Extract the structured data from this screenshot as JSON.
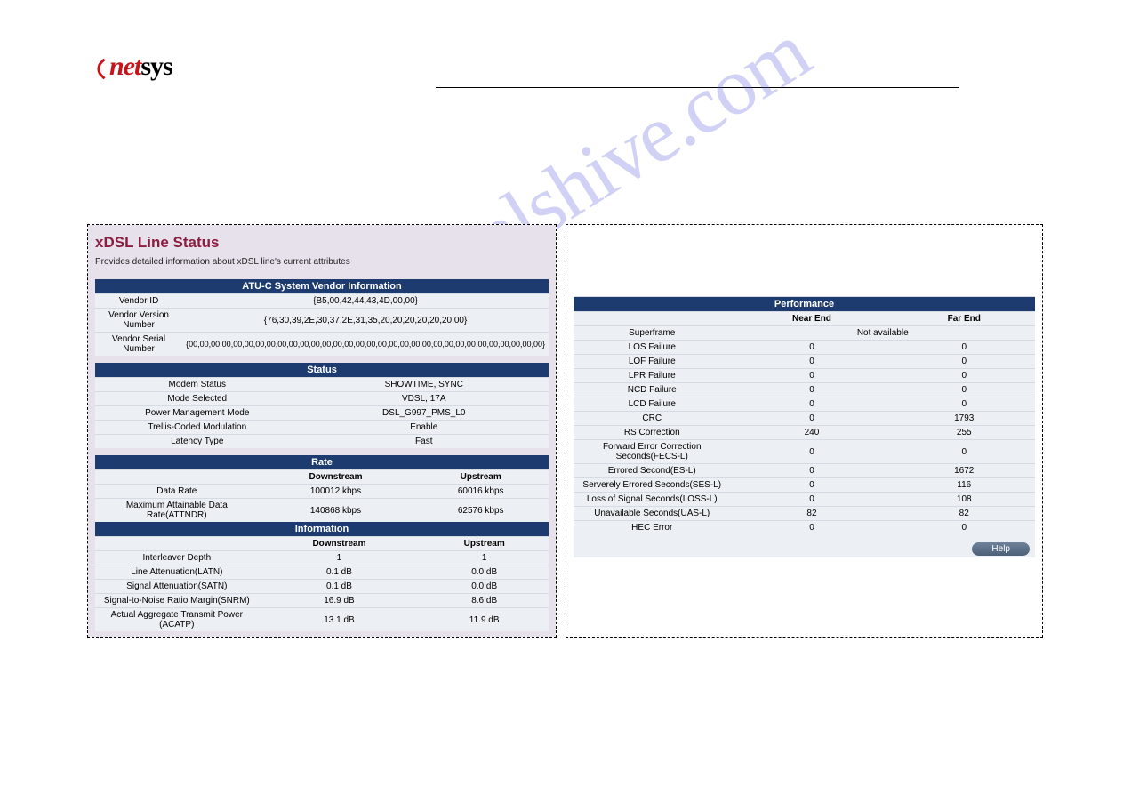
{
  "logo": {
    "part1": "net",
    "part2": "sys"
  },
  "watermark": "manualshive.com",
  "left": {
    "title": "xDSL Line Status",
    "subtitle": "Provides detailed information about xDSL line's current attributes",
    "vendor_section": "ATU-C System Vendor Information",
    "vendor_rows": [
      {
        "label": "Vendor ID",
        "value": "{B5,00,42,44,43,4D,00,00}"
      },
      {
        "label": "Vendor Version Number",
        "value": "{76,30,39,2E,30,37,2E,31,35,20,20,20,20,20,20,00}"
      },
      {
        "label": "Vendor Serial Number",
        "value": "{00,00,00,00,00,00,00,00,00,00,00,00,00,00,00,00,00,00,00,00,00,00,00,00,00,00,00,00,00,00,00,00}"
      }
    ],
    "status_section": "Status",
    "status_rows": [
      {
        "label": "Modem Status",
        "value": "SHOWTIME, SYNC"
      },
      {
        "label": "Mode Selected",
        "value": "VDSL, 17A"
      },
      {
        "label": "Power Management Mode",
        "value": "DSL_G997_PMS_L0"
      },
      {
        "label": "Trellis-Coded Modulation",
        "value": "Enable"
      },
      {
        "label": "Latency Type",
        "value": "Fast"
      }
    ],
    "rate_section": "Rate",
    "rate_headers": {
      "down": "Downstream",
      "up": "Upstream"
    },
    "rate_rows": [
      {
        "label": "Data Rate",
        "down": "100012 kbps",
        "up": "60016 kbps"
      },
      {
        "label": "Maximum Attainable Data Rate(ATTNDR)",
        "down": "140868 kbps",
        "up": "62576 kbps"
      }
    ],
    "info_section": "Information",
    "info_headers": {
      "down": "Downstream",
      "up": "Upstream"
    },
    "info_rows": [
      {
        "label": "Interleaver Depth",
        "down": "1",
        "up": "1"
      },
      {
        "label": "Line Attenuation(LATN)",
        "down": "0.1 dB",
        "up": "0.0 dB"
      },
      {
        "label": "Signal Attenuation(SATN)",
        "down": "0.1 dB",
        "up": "0.0 dB"
      },
      {
        "label": "Signal-to-Noise Ratio Margin(SNRM)",
        "down": "16.9 dB",
        "up": "8.6 dB"
      },
      {
        "label": "Actual Aggregate Transmit Power (ACATP)",
        "down": "13.1 dB",
        "up": "11.9 dB"
      }
    ]
  },
  "right": {
    "perf_section": "Performance",
    "perf_headers": {
      "near": "Near End",
      "far": "Far End"
    },
    "superframe": {
      "label": "Superframe",
      "value": "Not available"
    },
    "perf_rows": [
      {
        "label": "LOS Failure",
        "near": "0",
        "far": "0"
      },
      {
        "label": "LOF Failure",
        "near": "0",
        "far": "0"
      },
      {
        "label": "LPR Failure",
        "near": "0",
        "far": "0"
      },
      {
        "label": "NCD Failure",
        "near": "0",
        "far": "0"
      },
      {
        "label": "LCD Failure",
        "near": "0",
        "far": "0"
      },
      {
        "label": "CRC",
        "near": "0",
        "far": "1793"
      },
      {
        "label": "RS Correction",
        "near": "240",
        "far": "255"
      },
      {
        "label": "Forward Error Correction Seconds(FECS-L)",
        "near": "0",
        "far": "0"
      },
      {
        "label": "Errored Second(ES-L)",
        "near": "0",
        "far": "1672"
      },
      {
        "label": "Serverely Errored Seconds(SES-L)",
        "near": "0",
        "far": "116"
      },
      {
        "label": "Loss of Signal Seconds(LOSS-L)",
        "near": "0",
        "far": "108"
      },
      {
        "label": "Unavailable Seconds(UAS-L)",
        "near": "82",
        "far": "82"
      },
      {
        "label": "HEC Error",
        "near": "0",
        "far": "0"
      }
    ],
    "help_label": "Help"
  }
}
